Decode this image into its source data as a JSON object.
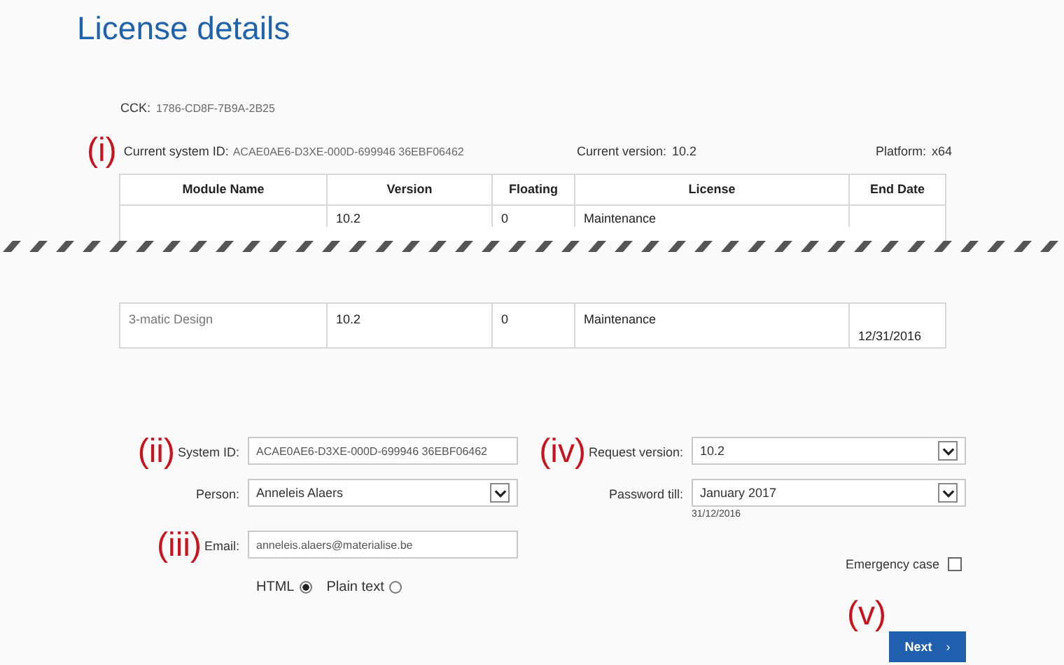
{
  "title": "License details",
  "cck": {
    "label": "CCK:",
    "value": "1786-CD8F-7B9A-2B25"
  },
  "system_info": {
    "marker": "(i)",
    "system_id_label": "Current system ID:",
    "system_id": "ACAE0AE6-D3XE-000D-699946 36EBF06462",
    "version_label": "Current version:",
    "version": "10.2",
    "platform_label": "Platform:",
    "platform": "x64"
  },
  "table": {
    "columns": [
      "Module Name",
      "Version",
      "Floating",
      "License",
      "End Date"
    ],
    "rows": [
      {
        "cells": {
          "version": "10.2",
          "floating": "0",
          "license": "Maintenance"
        }
      }
    ],
    "rows_after_break": [
      {
        "cells": {
          "module_name": "3-matic Design",
          "version": "10.2",
          "floating": "0",
          "license": "Maintenance",
          "end_date": "12/31/2016"
        }
      }
    ]
  },
  "form": {
    "left": [
      {
        "kind": "input",
        "marker": "(ii)",
        "label": "System ID:",
        "value": "ACAE0AE6-D3XE-000D-699946 36EBF06462"
      },
      {
        "kind": "select",
        "label": "Person:",
        "value": "Anneleis Alaers"
      },
      {
        "kind": "input",
        "marker": "(iii)",
        "label": "Email:",
        "value": "anneleis.alaers@materialise.be"
      }
    ],
    "right": [
      {
        "kind": "select",
        "marker": "(iv)",
        "label": "Request version:",
        "value": "10.2"
      },
      {
        "kind": "select",
        "label": "Password till:",
        "value": "January 2017",
        "note": "31/12/2016"
      }
    ],
    "emergency": {
      "label": "Emergency case",
      "checked": false
    },
    "formats": [
      {
        "label": "HTML",
        "selected": true
      },
      {
        "label": "Plain text",
        "selected": false
      }
    ],
    "next": {
      "marker": "(v)",
      "label": "Next",
      "arrow": "›"
    }
  }
}
